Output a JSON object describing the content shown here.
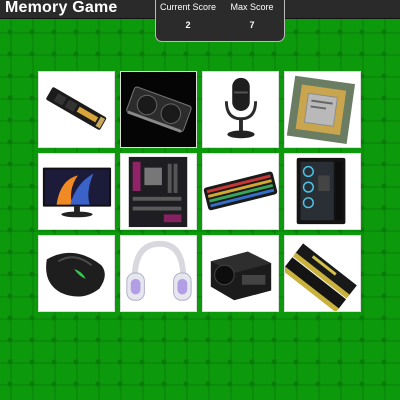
{
  "header": {
    "title": "Memory Game",
    "current_score_label": "Current Score",
    "current_score": "2",
    "max_score_label": "Max Score",
    "max_score": "7"
  },
  "theme": {
    "background": "#0c9a0c",
    "header_bg": "#2a2a2a",
    "card_bg": "#ffffff"
  },
  "cards": [
    {
      "image": "ssd-icon"
    },
    {
      "image": "graphics-card-icon"
    },
    {
      "image": "microphone-icon"
    },
    {
      "image": "cpu-icon"
    },
    {
      "image": "monitor-icon"
    },
    {
      "image": "motherboard-icon"
    },
    {
      "image": "keyboard-icon"
    },
    {
      "image": "pc-case-icon"
    },
    {
      "image": "mouse-icon"
    },
    {
      "image": "headset-icon"
    },
    {
      "image": "power-supply-icon"
    },
    {
      "image": "ram-icon"
    }
  ]
}
